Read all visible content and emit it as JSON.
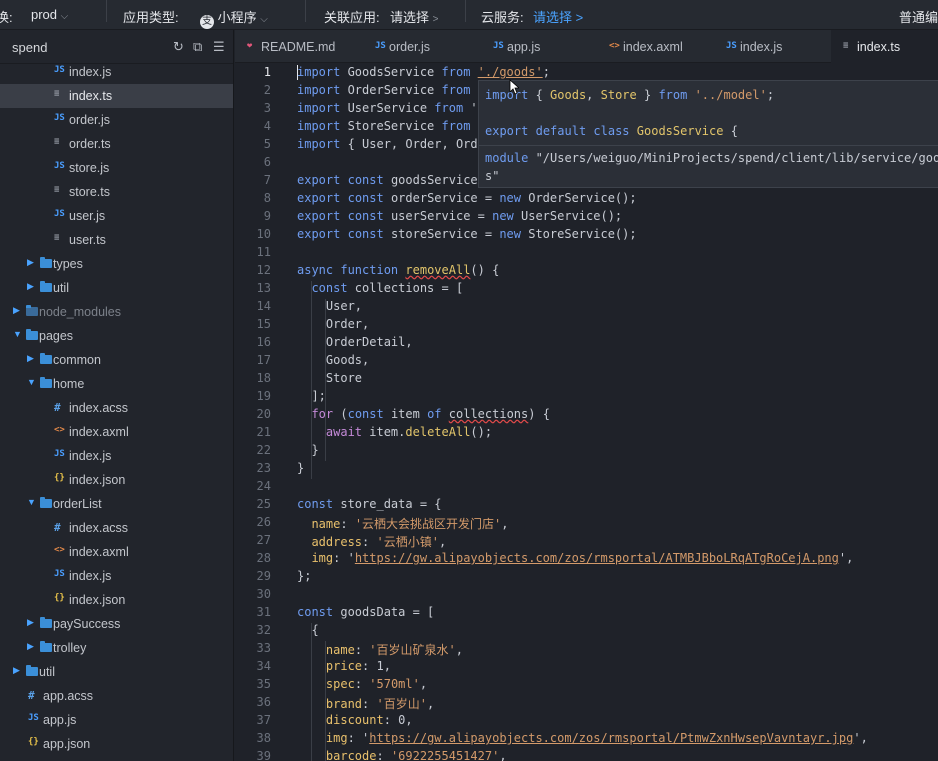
{
  "topbar": {
    "env_prefix": "换:",
    "env_value": "prod",
    "app_type_label": "应用类型:",
    "app_type_value": "小程序",
    "linked_app_label": "关联应用:",
    "linked_app_value": "请选择",
    "cloud_label": "云服务:",
    "cloud_value": "请选择 >",
    "mode_label": "普通编"
  },
  "sidebar": {
    "title": "spend",
    "items": [
      {
        "label": "index.js",
        "icon": "js-file-icon",
        "icon_text": "JS",
        "type": "js",
        "indent": 56
      },
      {
        "label": "index.ts",
        "icon": "ts-file-icon",
        "icon_text": "≡",
        "type": "ts",
        "indent": 56,
        "selected": true
      },
      {
        "label": "order.js",
        "icon": "js-file-icon",
        "icon_text": "JS",
        "type": "js",
        "indent": 56
      },
      {
        "label": "order.ts",
        "icon": "ts-file-icon",
        "icon_text": "≡",
        "type": "ts",
        "indent": 56
      },
      {
        "label": "store.js",
        "icon": "js-file-icon",
        "icon_text": "JS",
        "type": "js",
        "indent": 56
      },
      {
        "label": "store.ts",
        "icon": "ts-file-icon",
        "icon_text": "≡",
        "type": "ts",
        "indent": 56
      },
      {
        "label": "user.js",
        "icon": "js-file-icon",
        "icon_text": "JS",
        "type": "js",
        "indent": 56
      },
      {
        "label": "user.ts",
        "icon": "ts-file-icon",
        "icon_text": "≡",
        "type": "ts",
        "indent": 56
      },
      {
        "label": "types",
        "icon": "folder-icon",
        "type": "folder",
        "expanded": false,
        "indent": 40
      },
      {
        "label": "util",
        "icon": "folder-icon",
        "type": "folder",
        "expanded": false,
        "indent": 40
      },
      {
        "label": "node_modules",
        "icon": "folder-icon",
        "type": "folder",
        "expanded": false,
        "indent": 26,
        "dim": true
      },
      {
        "label": "pages",
        "icon": "folder-icon",
        "type": "folder",
        "expanded": true,
        "indent": 26
      },
      {
        "label": "common",
        "icon": "folder-icon",
        "type": "folder",
        "expanded": false,
        "indent": 40
      },
      {
        "label": "home",
        "icon": "folder-icon",
        "type": "folder",
        "expanded": true,
        "indent": 40
      },
      {
        "label": "index.acss",
        "icon": "acss-file-icon",
        "icon_text": "#",
        "type": "acss",
        "indent": 56
      },
      {
        "label": "index.axml",
        "icon": "axml-file-icon",
        "icon_text": "<>",
        "type": "axml",
        "indent": 56
      },
      {
        "label": "index.js",
        "icon": "js-file-icon",
        "icon_text": "JS",
        "type": "js",
        "indent": 56
      },
      {
        "label": "index.json",
        "icon": "json-file-icon",
        "icon_text": "{}",
        "type": "json",
        "indent": 56
      },
      {
        "label": "orderList",
        "icon": "folder-icon",
        "type": "folder",
        "expanded": true,
        "indent": 40
      },
      {
        "label": "index.acss",
        "icon": "acss-file-icon",
        "icon_text": "#",
        "type": "acss",
        "indent": 56
      },
      {
        "label": "index.axml",
        "icon": "axml-file-icon",
        "icon_text": "<>",
        "type": "axml",
        "indent": 56
      },
      {
        "label": "index.js",
        "icon": "js-file-icon",
        "icon_text": "JS",
        "type": "js",
        "indent": 56
      },
      {
        "label": "index.json",
        "icon": "json-file-icon",
        "icon_text": "{}",
        "type": "json",
        "indent": 56
      },
      {
        "label": "paySuccess",
        "icon": "folder-icon",
        "type": "folder",
        "expanded": false,
        "indent": 40
      },
      {
        "label": "trolley",
        "icon": "folder-icon",
        "type": "folder",
        "expanded": false,
        "indent": 40
      },
      {
        "label": "util",
        "icon": "folder-icon",
        "type": "folder",
        "expanded": false,
        "indent": 26
      },
      {
        "label": "app.acss",
        "icon": "acss-file-icon",
        "icon_text": "#",
        "type": "acss",
        "indent": 30
      },
      {
        "label": "app.js",
        "icon": "js-file-icon",
        "icon_text": "JS",
        "type": "js",
        "indent": 30
      },
      {
        "label": "app.json",
        "icon": "json-file-icon",
        "icon_text": "{}",
        "type": "json",
        "indent": 30
      }
    ]
  },
  "tabs": [
    {
      "label": "README.md",
      "icon": "markdown-file-icon",
      "icon_text": "❤",
      "type": "md"
    },
    {
      "label": "order.js",
      "icon": "js-file-icon",
      "icon_text": "JS",
      "type": "js"
    },
    {
      "label": "app.js",
      "icon": "js-file-icon",
      "icon_text": "JS",
      "type": "js"
    },
    {
      "label": "index.axml",
      "icon": "axml-file-icon",
      "icon_text": "<>",
      "type": "axml"
    },
    {
      "label": "index.js",
      "icon": "js-file-icon",
      "icon_text": "JS",
      "type": "js"
    },
    {
      "label": "index.ts",
      "icon": "ts-file-icon",
      "icon_text": "≡",
      "type": "ts",
      "active": true
    }
  ],
  "editor": {
    "current_line": 1,
    "lines": [
      [
        [
          "import",
          "kw"
        ],
        [
          " GoodsService ",
          ""
        ],
        [
          "from",
          "kw"
        ],
        [
          " ",
          ""
        ],
        [
          "'./goods'",
          "str url"
        ],
        [
          ";",
          ""
        ]
      ],
      [
        [
          "import",
          "kw"
        ],
        [
          " OrderService ",
          ""
        ],
        [
          "from",
          "kw"
        ]
      ],
      [
        [
          "import",
          "kw"
        ],
        [
          " UserService ",
          ""
        ],
        [
          "from",
          "kw"
        ],
        [
          " '",
          ""
        ]
      ],
      [
        [
          "import",
          "kw"
        ],
        [
          " StoreService ",
          ""
        ],
        [
          "from",
          "kw"
        ]
      ],
      [
        [
          "import",
          "kw"
        ],
        [
          " { User, Order, Ord",
          ""
        ]
      ],
      [],
      [
        [
          "export",
          "kw"
        ],
        [
          " ",
          ""
        ],
        [
          "const",
          "kw"
        ],
        [
          " goodsService",
          ""
        ]
      ],
      [
        [
          "export",
          "kw"
        ],
        [
          " ",
          ""
        ],
        [
          "const",
          "kw"
        ],
        [
          " orderService = ",
          ""
        ],
        [
          "new",
          "kw"
        ],
        [
          " OrderService();",
          ""
        ]
      ],
      [
        [
          "export",
          "kw"
        ],
        [
          " ",
          ""
        ],
        [
          "const",
          "kw"
        ],
        [
          " userService = ",
          ""
        ],
        [
          "new",
          "kw"
        ],
        [
          " UserService();",
          ""
        ]
      ],
      [
        [
          "export",
          "kw"
        ],
        [
          " ",
          ""
        ],
        [
          "const",
          "kw"
        ],
        [
          " storeService = ",
          ""
        ],
        [
          "new",
          "kw"
        ],
        [
          " StoreService();",
          ""
        ]
      ],
      [],
      [
        [
          "async",
          "kw"
        ],
        [
          " ",
          ""
        ],
        [
          "function",
          "kw"
        ],
        [
          " ",
          ""
        ],
        [
          "removeAll",
          "fn err"
        ],
        [
          "() {",
          ""
        ]
      ],
      [
        [
          "  ",
          ""
        ],
        [
          "const",
          "kw"
        ],
        [
          " collections = [",
          ""
        ]
      ],
      [
        [
          "    User,",
          ""
        ]
      ],
      [
        [
          "    Order,",
          ""
        ]
      ],
      [
        [
          "    OrderDetail,",
          ""
        ]
      ],
      [
        [
          "    Goods,",
          ""
        ]
      ],
      [
        [
          "    Store",
          ""
        ]
      ],
      [
        [
          "  ];",
          ""
        ]
      ],
      [
        [
          "  ",
          ""
        ],
        [
          "for",
          "kw2"
        ],
        [
          " (",
          ""
        ],
        [
          "const",
          "kw"
        ],
        [
          " item ",
          ""
        ],
        [
          "of",
          "kw"
        ],
        [
          " ",
          ""
        ],
        [
          "collections",
          "err"
        ],
        [
          ") {",
          ""
        ]
      ],
      [
        [
          "    ",
          ""
        ],
        [
          "await",
          "kw2"
        ],
        [
          " item.",
          ""
        ],
        [
          "deleteAll",
          "fn"
        ],
        [
          "();",
          ""
        ]
      ],
      [
        [
          "  }",
          ""
        ]
      ],
      [
        [
          "}",
          ""
        ]
      ],
      [],
      [
        [
          "const",
          "kw"
        ],
        [
          " store_data = {",
          ""
        ]
      ],
      [
        [
          "  ",
          ""
        ],
        [
          "name",
          "prop"
        ],
        [
          ": ",
          ""
        ],
        [
          "'云栖大会挑战区开发门店'",
          "str"
        ],
        [
          ",",
          ""
        ]
      ],
      [
        [
          "  ",
          ""
        ],
        [
          "address",
          "prop"
        ],
        [
          ": ",
          ""
        ],
        [
          "'云栖小镇'",
          "str"
        ],
        [
          ",",
          ""
        ]
      ],
      [
        [
          "  ",
          ""
        ],
        [
          "img",
          "prop"
        ],
        [
          ": ",
          ""
        ],
        [
          "'",
          ""
        ],
        [
          "https://gw.alipayobjects.com/zos/rmsportal/ATMBJBboLRqATgRoCejA.png",
          "str url"
        ],
        [
          "'",
          ""
        ],
        [
          ",",
          ""
        ]
      ],
      [
        [
          "};",
          ""
        ]
      ],
      [],
      [
        [
          "const",
          "kw"
        ],
        [
          " goodsData = [",
          ""
        ]
      ],
      [
        [
          "  {",
          ""
        ]
      ],
      [
        [
          "    ",
          ""
        ],
        [
          "name",
          "prop"
        ],
        [
          ": ",
          ""
        ],
        [
          "'百岁山矿泉水'",
          "str"
        ],
        [
          ",",
          ""
        ]
      ],
      [
        [
          "    ",
          ""
        ],
        [
          "price",
          "prop"
        ],
        [
          ": 1,",
          ""
        ]
      ],
      [
        [
          "    ",
          ""
        ],
        [
          "spec",
          "prop"
        ],
        [
          ": ",
          ""
        ],
        [
          "'570ml'",
          "str"
        ],
        [
          ",",
          ""
        ]
      ],
      [
        [
          "    ",
          ""
        ],
        [
          "brand",
          "prop"
        ],
        [
          ": ",
          ""
        ],
        [
          "'百岁山'",
          "str"
        ],
        [
          ",",
          ""
        ]
      ],
      [
        [
          "    ",
          ""
        ],
        [
          "discount",
          "prop"
        ],
        [
          ": 0,",
          ""
        ]
      ],
      [
        [
          "    ",
          ""
        ],
        [
          "img",
          "prop"
        ],
        [
          ": '",
          ""
        ],
        [
          "https://gw.alipayobjects.com/zos/rmsportal/PtmwZxnHwsepVavntayr.jpg",
          "str url"
        ],
        [
          "',",
          ""
        ]
      ],
      [
        [
          "    ",
          ""
        ],
        [
          "barcode",
          "prop"
        ],
        [
          ": ",
          ""
        ],
        [
          "'6922255451427'",
          "str"
        ],
        [
          ",",
          ""
        ]
      ]
    ]
  },
  "hover": {
    "line1": [
      [
        "import",
        "kw"
      ],
      [
        " { ",
        ""
      ],
      [
        "Goods",
        "fn"
      ],
      [
        ", ",
        ""
      ],
      [
        "Store",
        "fn"
      ],
      [
        " } ",
        ""
      ],
      [
        "from",
        "kw"
      ],
      [
        " ",
        ""
      ],
      [
        "'../model'",
        "str"
      ],
      [
        ";",
        ""
      ]
    ],
    "line2": [
      [
        "export",
        "kw"
      ],
      [
        " ",
        ""
      ],
      [
        "default",
        "kw"
      ],
      [
        " ",
        ""
      ],
      [
        "class",
        "kw"
      ],
      [
        " ",
        ""
      ],
      [
        "GoodsService",
        "fn"
      ],
      [
        " {",
        ""
      ]
    ],
    "line3": [
      [
        "module",
        "kw"
      ],
      [
        " \"/Users/weiguo/MiniProjects/spend/client/lib/service/goods.t",
        ""
      ]
    ],
    "line4": [
      [
        "s\"",
        ""
      ]
    ]
  },
  "colors": {
    "accent": "#4aa3ff",
    "bg": "#1f2229",
    "sidebar": "#22252c"
  }
}
